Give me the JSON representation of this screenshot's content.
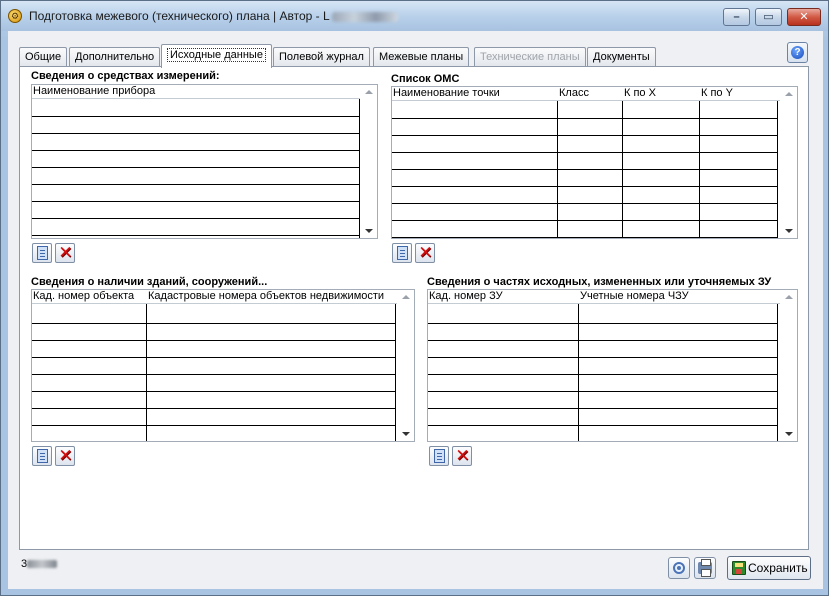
{
  "window": {
    "title": "Подготовка межевого (технического) плана | Автор - ",
    "title_suffix": "L",
    "buttons": {
      "minimize": "–",
      "maximize": "▭",
      "close": "✕"
    }
  },
  "tabs": [
    {
      "label": "Общие",
      "active": false,
      "disabled": false
    },
    {
      "label": "Дополнительно",
      "active": false,
      "disabled": false
    },
    {
      "label": "Исходные данные",
      "active": true,
      "disabled": false
    },
    {
      "label": "Полевой журнал",
      "active": false,
      "disabled": false
    },
    {
      "label": "Межевые планы",
      "active": false,
      "disabled": false
    },
    {
      "label": "Технические планы",
      "active": false,
      "disabled": true
    },
    {
      "label": "Документы",
      "active": false,
      "disabled": false
    }
  ],
  "help": {
    "label": "?"
  },
  "sections": {
    "instruments": {
      "title": "Сведения о средствах измерений:",
      "columns": [
        "Наименование прибора"
      ]
    },
    "oms": {
      "title": "Список ОМС",
      "columns": [
        "Наименование точки",
        "Класс",
        "К по X",
        "К по Y"
      ]
    },
    "buildings": {
      "title": "Сведения о наличии зданий, сооружений...",
      "columns": [
        "Кад. номер объекта",
        "Кадастровые номера объектов недвижимости"
      ]
    },
    "parts": {
      "title": "Сведения о частях исходных, измененных или уточняемых ЗУ",
      "columns": [
        "Кад. номер ЗУ",
        "Учетные номера ЧЗУ"
      ]
    }
  },
  "icons": {
    "add": "✕"
  },
  "status": {
    "code_prefix": "3"
  },
  "footer": {
    "save_label": "Сохранить"
  }
}
